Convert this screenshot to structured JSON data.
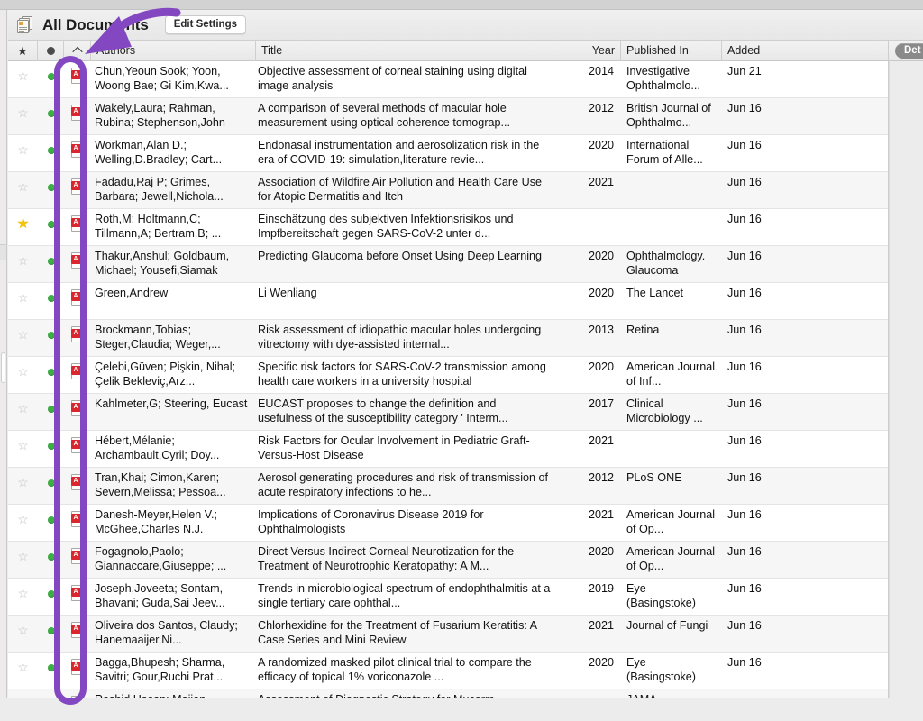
{
  "window": {
    "title": "All Documents",
    "title_icon": "documents-stack-icon",
    "edit_settings_label": "Edit Settings"
  },
  "inspector": {
    "tab_label": "Det"
  },
  "columns": {
    "star": "star-icon",
    "read_status": "filled-dot-icon",
    "sort": "chevron-up-icon",
    "authors": "Authors",
    "title": "Title",
    "year": "Year",
    "published_in": "Published In",
    "added": "Added"
  },
  "colors": {
    "annotation": "#8247c1",
    "pdf_badge": "#d9272d",
    "green_dot": "#3cb043",
    "starred": "#f1c40f",
    "tab_pill": "#8a8a8a"
  },
  "annotations": [
    {
      "type": "arrow",
      "target": "sort-column-chevron",
      "color": "#8247c1"
    },
    {
      "type": "oval",
      "target": "pdf-attachment-column",
      "color": "#8247c1"
    }
  ],
  "rows": [
    {
      "starred": false,
      "authors": "Chun,Yeoun Sook; Yoon, Woong Bae; Gi Kim,Kwa...",
      "title": "Objective assessment of corneal staining using digital image analysis",
      "year": "2014",
      "published_in": "Investigative Ophthalmolo...",
      "added": "Jun 21"
    },
    {
      "starred": false,
      "authors": "Wakely,Laura; Rahman, Rubina; Stephenson,John",
      "title": "A comparison of several methods of macular hole measurement using optical coherence tomograp...",
      "year": "2012",
      "published_in": "British Journal of Ophthalmo...",
      "added": "Jun 16"
    },
    {
      "starred": false,
      "authors": "Workman,Alan D.; Welling,D.Bradley; Cart...",
      "title": "Endonasal instrumentation and aerosolization risk in the era of COVID-19: simulation,literature revie...",
      "year": "2020",
      "published_in": "International Forum of Alle...",
      "added": "Jun 16"
    },
    {
      "starred": false,
      "authors": "Fadadu,Raj P; Grimes, Barbara; Jewell,Nichola...",
      "title": "Association of Wildfire Air Pollution and Health Care Use for Atopic Dermatitis and Itch",
      "year": "2021",
      "published_in": "",
      "added": "Jun 16"
    },
    {
      "starred": true,
      "authors": "Roth,M; Holtmann,C; Tillmann,A; Bertram,B; ...",
      "title": "Einschätzung des subjektiven Infektionsrisikos und Impfbereitschaft gegen SARS-CoV-2 unter d...",
      "year": "",
      "published_in": "",
      "added": "Jun 16"
    },
    {
      "starred": false,
      "authors": "Thakur,Anshul; Goldbaum, Michael; Yousefi,Siamak",
      "title": "Predicting Glaucoma before Onset Using Deep Learning",
      "year": "2020",
      "published_in": "Ophthalmology. Glaucoma",
      "added": "Jun 16"
    },
    {
      "starred": false,
      "authors": "Green,Andrew",
      "title": "Li Wenliang",
      "year": "2020",
      "published_in": "The Lancet",
      "added": "Jun 16"
    },
    {
      "starred": false,
      "authors": "Brockmann,Tobias; Steger,Claudia; Weger,...",
      "title": "Risk assessment of idiopathic macular holes undergoing vitrectomy with dye-assisted internal...",
      "year": "2013",
      "published_in": "Retina",
      "added": "Jun 16"
    },
    {
      "starred": false,
      "authors": "Çelebi,Güven; Pişkin, Nihal; Çelik Bekleviç,Arz...",
      "title": "Specific risk factors for SARS-CoV-2 transmission among health care workers in a university hospital",
      "year": "2020",
      "published_in": "American Journal of Inf...",
      "added": "Jun 16"
    },
    {
      "starred": false,
      "authors": "Kahlmeter,G; Steering, Eucast",
      "title": "EUCAST proposes to change the definition and usefulness of the susceptibility category ' Interm...",
      "year": "2017",
      "published_in": "Clinical Microbiology ...",
      "added": "Jun 16"
    },
    {
      "starred": false,
      "authors": "Hébert,Mélanie; Archambault,Cyril; Doy...",
      "title": "Risk Factors for Ocular Involvement in Pediatric Graft-Versus-Host Disease",
      "year": "2021",
      "published_in": "",
      "added": "Jun 16"
    },
    {
      "starred": false,
      "authors": "Tran,Khai; Cimon,Karen; Severn,Melissa; Pessoa...",
      "title": "Aerosol generating procedures and risk of transmission of acute respiratory infections to he...",
      "year": "2012",
      "published_in": "PLoS ONE",
      "added": "Jun 16"
    },
    {
      "starred": false,
      "authors": "Danesh-Meyer,Helen V.; McGhee,Charles N.J.",
      "title": "Implications of Coronavirus Disease 2019 for Ophthalmologists",
      "year": "2021",
      "published_in": "American Journal of Op...",
      "added": "Jun 16"
    },
    {
      "starred": false,
      "authors": "Fogagnolo,Paolo; Giannaccare,Giuseppe; ...",
      "title": "Direct Versus Indirect Corneal Neurotization for the Treatment of Neurotrophic Keratopathy: A M...",
      "year": "2020",
      "published_in": "American Journal of Op...",
      "added": "Jun 16"
    },
    {
      "starred": false,
      "authors": "Joseph,Joveeta; Sontam, Bhavani; Guda,Sai Jeev...",
      "title": "Trends in microbiological spectrum of endophthalmitis at a single tertiary care ophthal...",
      "year": "2019",
      "published_in": "Eye (Basingstoke)",
      "added": "Jun 16"
    },
    {
      "starred": false,
      "authors": "Oliveira dos Santos, Claudy; Hanemaaijer,Ni...",
      "title": "Chlorhexidine for the Treatment of Fusarium Keratitis: A Case Series and Mini Review",
      "year": "2021",
      "published_in": "Journal of Fungi",
      "added": "Jun 16"
    },
    {
      "starred": false,
      "authors": "Bagga,Bhupesh; Sharma, Savitri; Gour,Ruchi Prat...",
      "title": "A randomized masked pilot clinical trial to compare the efficacy of topical 1% voriconazole ...",
      "year": "2020",
      "published_in": "Eye (Basingstoke)",
      "added": "Jun 16"
    },
    {
      "starred": false,
      "authors": "Rashid,Hasan; Majjan...",
      "title": "Assessment of Diagnostic Strategy for Mucorm...",
      "year": "",
      "published_in": "JAMA",
      "added": ""
    }
  ]
}
